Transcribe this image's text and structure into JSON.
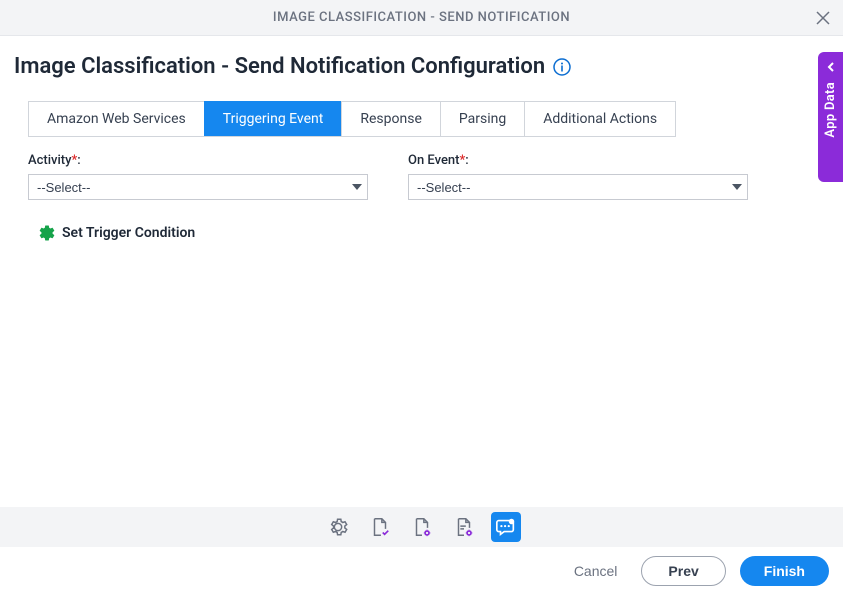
{
  "header": {
    "title": "IMAGE CLASSIFICATION - SEND NOTIFICATION"
  },
  "page": {
    "title": "Image Classification - Send Notification Configuration"
  },
  "tabs": [
    {
      "label": "Amazon Web Services",
      "active": false
    },
    {
      "label": "Triggering Event",
      "active": true
    },
    {
      "label": "Response",
      "active": false
    },
    {
      "label": "Parsing",
      "active": false
    },
    {
      "label": "Additional Actions",
      "active": false
    }
  ],
  "form": {
    "activity": {
      "label": "Activity",
      "required_marker": "*",
      "colon": ":",
      "selected": "--Select--"
    },
    "on_event": {
      "label": "On Event",
      "required_marker": "*",
      "colon": ":",
      "selected": "--Select--"
    }
  },
  "trigger_condition": {
    "label": "Set Trigger Condition"
  },
  "side_panel": {
    "label": "App Data"
  },
  "footer": {
    "cancel": "Cancel",
    "prev": "Prev",
    "finish": "Finish"
  }
}
